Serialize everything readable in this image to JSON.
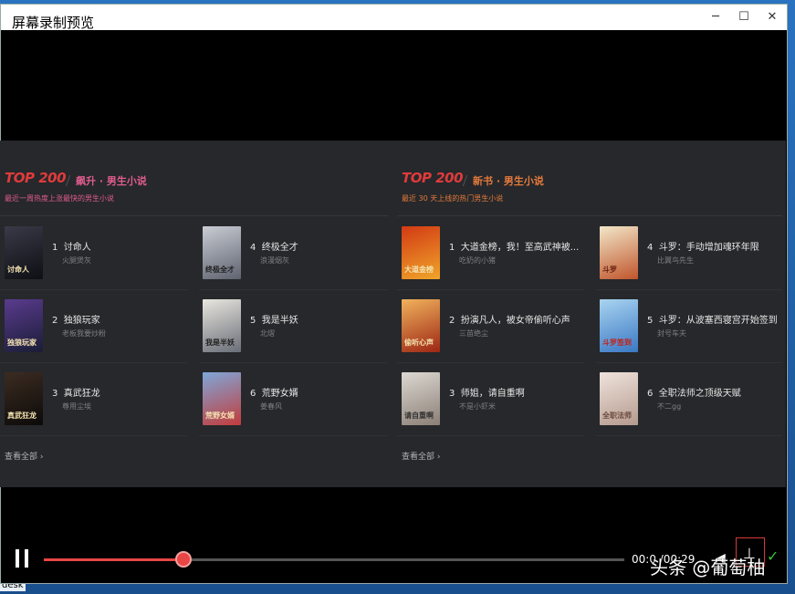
{
  "window": {
    "title": "屏幕录制预览",
    "minimize": "─",
    "maximize": "☐",
    "close": "✕"
  },
  "desktop": {
    "label": "desk"
  },
  "left_panel": {
    "logo": "TOP 200",
    "category": "飙升 · 男生小说",
    "category_color": "#e05c8c",
    "subtitle": "最近一周热度上涨最快的男生小说",
    "view_all": "查看全部 ›",
    "books": [
      {
        "rank": "1",
        "title": "讨命人",
        "author": "火腿煲灰",
        "cover": "讨命人"
      },
      {
        "rank": "2",
        "title": "独狼玩家",
        "author": "老板我要炒粉",
        "cover": "独狼玩家"
      },
      {
        "rank": "3",
        "title": "真武狂龙",
        "author": "尊用尘埃",
        "cover": "真武狂龙"
      },
      {
        "rank": "4",
        "title": "终极全才",
        "author": "浪漫烟灰",
        "cover": "终极全才"
      },
      {
        "rank": "5",
        "title": "我是半妖",
        "author": "北熠",
        "cover": "我是半妖"
      },
      {
        "rank": "6",
        "title": "荒野女婿",
        "author": "姜春风",
        "cover": "荒野女婿"
      }
    ]
  },
  "right_panel": {
    "logo": "TOP 200",
    "category": "新书 · 男生小说",
    "category_color": "#e57a3c",
    "subtitle": "最近 30 天上线的热门男生小说",
    "view_all": "查看全部 ›",
    "books": [
      {
        "rank": "1",
        "title": "大道金榜，我！至高武神被...",
        "author": "吃奶的小猪",
        "cover": "大道金榜"
      },
      {
        "rank": "2",
        "title": "扮演凡人，被女帝偷听心声",
        "author": "三苗绝尘",
        "cover": "偷听心声"
      },
      {
        "rank": "3",
        "title": "师姐，请自重啊",
        "author": "不是小虾米",
        "cover": "请自重啊"
      },
      {
        "rank": "4",
        "title": "斗罗：手动增加魂环年限",
        "author": "比翼鸟先生",
        "cover": "斗罗"
      },
      {
        "rank": "5",
        "title": "斗罗：从波塞西寝宫开始签到",
        "author": "封号车夫",
        "cover": "斗罗签到"
      },
      {
        "rank": "6",
        "title": "全职法师之顶级天赋",
        "author": "不二gg",
        "cover": "全职法师"
      }
    ]
  },
  "player": {
    "pause_icon": "pause-icon",
    "progress": 0.24,
    "timecode": "00:0 /00:29",
    "volume_icon": "◀",
    "pin_icon": "⊥",
    "confirm_icon": "✓"
  },
  "watermark": "头条 @葡萄柚"
}
